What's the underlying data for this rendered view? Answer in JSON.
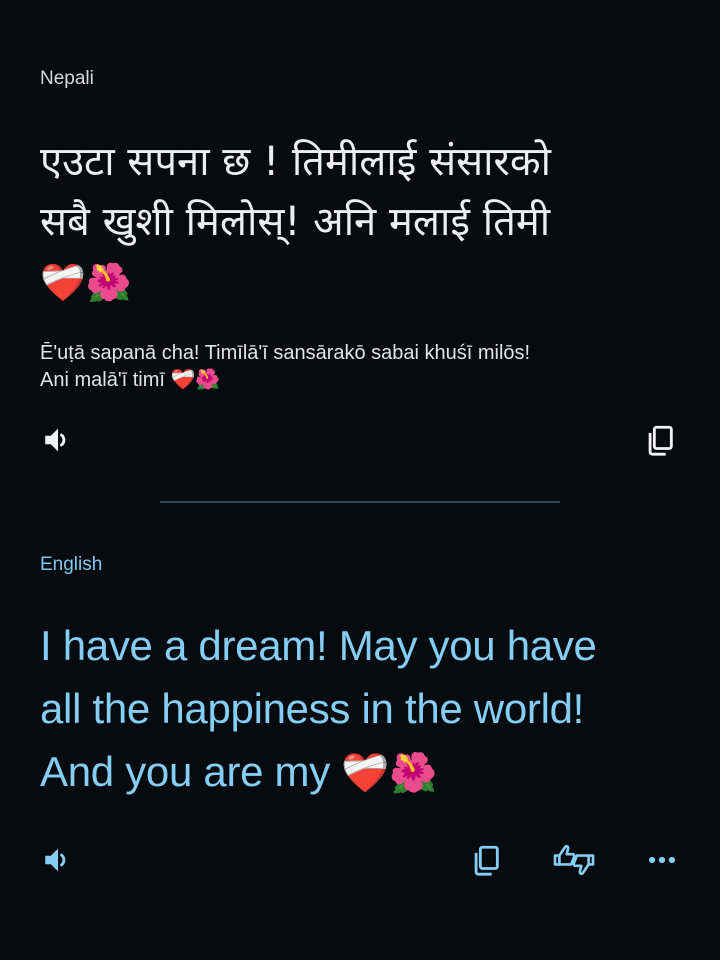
{
  "source": {
    "language": "Nepali",
    "line1": "एउटा सपना छ !  तिमीलाई संसारको",
    "line2": "सबै खुशी मिलोस्! अनि मलाई तिमी",
    "emojis": "❤️‍🩹🌺",
    "transliteration_line1": "Ē'uṭā sapanā cha!  Timīlā'ī sansārakō sabai khuśī milōs!",
    "transliteration_line2": "Ani malā'ī timī ❤️‍🩹🌺"
  },
  "target": {
    "language": "English",
    "line1": "I have a dream! May you have",
    "line2": "all the happiness in the world!",
    "line3": "And you are my",
    "emojis": "❤️‍🩹🌺"
  },
  "icons": {
    "source_speaker": "speaker-icon",
    "source_copy": "copy-icon",
    "target_speaker": "speaker-icon",
    "target_copy": "copy-icon",
    "target_feedback": "thumbs-up-down-icon",
    "target_more": "more-horizontal-icon"
  },
  "colors": {
    "background": "#060b10",
    "source_text": "#eceef0",
    "target_text": "#86cdf3",
    "target_label": "#82c8ef",
    "divider": "#2c4a56"
  }
}
